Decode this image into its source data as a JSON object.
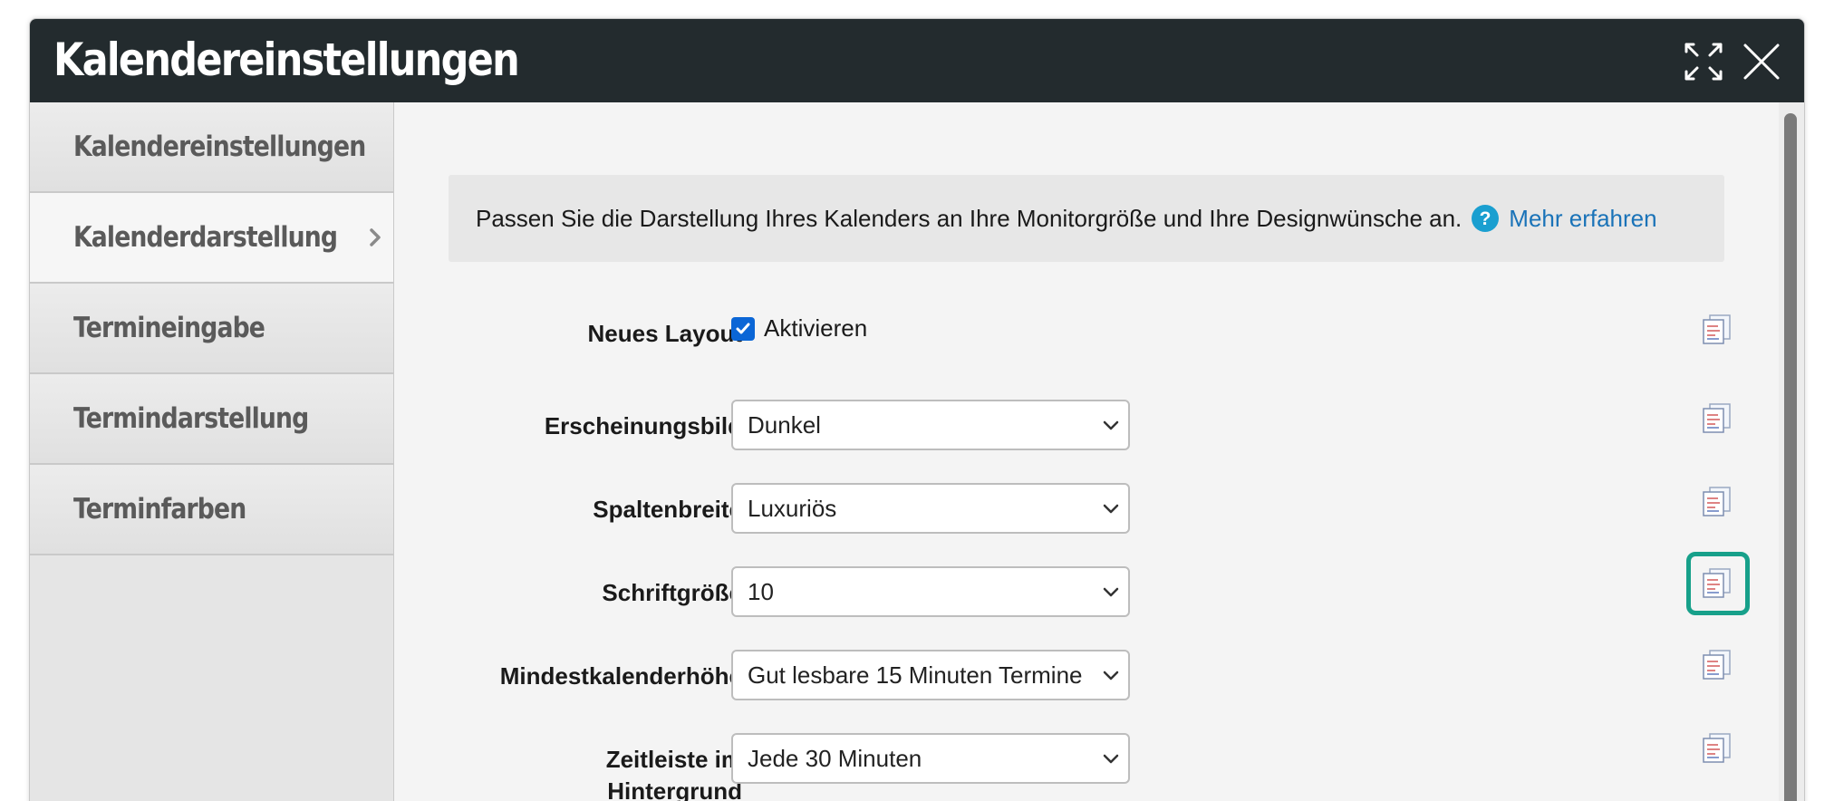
{
  "dialog": {
    "title": "Kalendereinstellungen",
    "icons": {
      "expand": "expand-icon",
      "close": "close-icon"
    }
  },
  "sidebar": {
    "items": [
      {
        "label": "Kalendereinstellungen",
        "active": false
      },
      {
        "label": "Kalenderdarstellung",
        "active": true
      },
      {
        "label": "Termineingabe",
        "active": false
      },
      {
        "label": "Termindarstellung",
        "active": false
      },
      {
        "label": "Terminfarben",
        "active": false
      }
    ]
  },
  "info": {
    "text": "Passen Sie die Darstellung Ihres Kalenders an Ihre Monitorgröße und Ihre Designwünsche an.",
    "link": "Mehr erfahren"
  },
  "settings": {
    "new_layout": {
      "label": "Neues Layout",
      "checkbox_label": "Aktivieren",
      "checked": true
    },
    "appearance": {
      "label": "Erscheinungsbild",
      "value": "Dunkel"
    },
    "column_width": {
      "label": "Spaltenbreite",
      "value": "Luxuriös"
    },
    "font_size": {
      "label": "Schriftgröße",
      "value": "10"
    },
    "min_height": {
      "label": "Mindestkalenderhöhe",
      "value": "Gut lesbare 15 Minuten Termine"
    },
    "timeline": {
      "label_line1": "Zeitleiste im",
      "label_line2": "Hintergrund",
      "value": "Jede 30 Minuten"
    }
  },
  "colors": {
    "titlebar": "#232b2e",
    "link": "#1a73b8",
    "checkbox": "#0b66d6",
    "highlight": "#17a08a"
  }
}
